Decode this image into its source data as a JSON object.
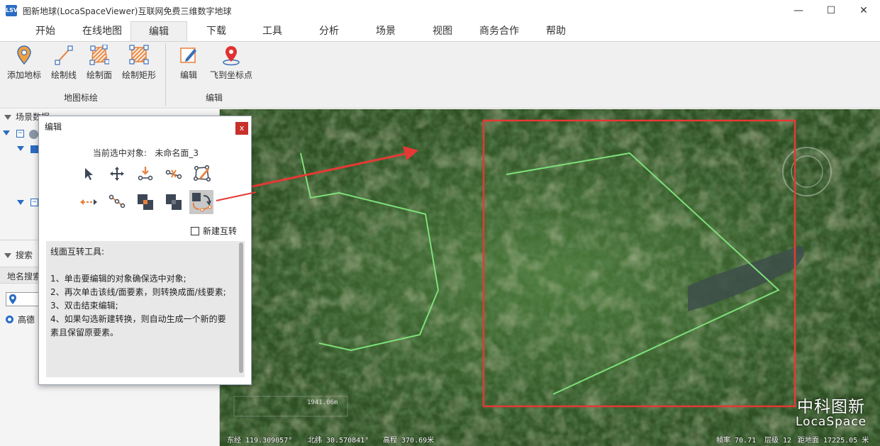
{
  "window": {
    "title": "图新地球(LocaSpaceViewer)互联网免费三维数字地球",
    "icon_label": "LSV",
    "controls": [
      "minimize-icon",
      "maximize-icon",
      "close-icon"
    ]
  },
  "tabs": [
    {
      "label": "开始",
      "active": false
    },
    {
      "label": "在线地图",
      "active": false
    },
    {
      "label": "编辑",
      "active": true
    },
    {
      "label": "下载",
      "active": false
    },
    {
      "label": "工具",
      "active": false
    },
    {
      "label": "分析",
      "active": false
    },
    {
      "label": "场景",
      "active": false
    },
    {
      "label": "视图",
      "active": false
    },
    {
      "label": "商务合作",
      "active": false
    },
    {
      "label": "帮助",
      "active": false
    }
  ],
  "ribbon": {
    "groups": [
      {
        "label": "地图标绘",
        "buttons": [
          {
            "label": "添加地标",
            "icon": "placemark-pin-icon"
          },
          {
            "label": "绘制线",
            "icon": "draw-line-icon"
          },
          {
            "label": "绘制面",
            "icon": "draw-polygon-icon"
          },
          {
            "label": "绘制矩形",
            "icon": "draw-rectangle-icon"
          }
        ]
      },
      {
        "label": "编辑",
        "buttons": [
          {
            "label": "编辑",
            "icon": "edit-pencil-icon"
          },
          {
            "label": "飞到坐标点",
            "icon": "fly-to-coordinate-icon"
          }
        ]
      }
    ]
  },
  "left_panel": {
    "scene_header": "场景数据",
    "search_header": "搜索",
    "place_search_label": "地名搜索",
    "provider_radio": "高德"
  },
  "dialog": {
    "title": "编辑",
    "close_label": "x",
    "selected_prefix": "当前选中对象:",
    "selected_value": "未命名面_3",
    "tools": [
      {
        "icon": "select-arrow-icon",
        "active": false
      },
      {
        "icon": "move-icon",
        "active": false
      },
      {
        "icon": "insert-vertex-icon",
        "active": false
      },
      {
        "icon": "delete-vertex-icon",
        "active": false
      },
      {
        "icon": "edit-shape-icon",
        "active": false
      },
      {
        "icon": "reverse-direction-icon",
        "active": false
      },
      {
        "icon": "split-line-icon",
        "active": false
      },
      {
        "icon": "union-icon",
        "active": false
      },
      {
        "icon": "difference-icon",
        "active": false
      },
      {
        "icon": "line-polygon-convert-icon",
        "active": true
      }
    ],
    "checkbox_label": "新建互转",
    "checkbox_checked": false,
    "help": {
      "title": "线面互转工具:",
      "lines": [
        "1、单击要编辑的对象确保选中对象;",
        "2、再次单击该线/面要素，则转换成面/线要素;",
        "3、双击结束编辑;",
        "4、如果勾选新建转换，则自动生成一个新的要素且保留原要素。"
      ]
    }
  },
  "map": {
    "scale_label": "1941.06m",
    "status": {
      "lon": "东经 119.309057°",
      "lat": "北纬 30.570841°",
      "elev": "高程 370.69米",
      "fps": "帧率 70.71",
      "level": "层级 12",
      "distance": "距地面 17225.05 米"
    },
    "watermark_cn": "中科图新",
    "watermark_en": "LocaSpace",
    "colors": {
      "line_feature": "#7ee07a",
      "highlight_rect": "#e53935",
      "annotation_arrow": "#e53935"
    }
  }
}
